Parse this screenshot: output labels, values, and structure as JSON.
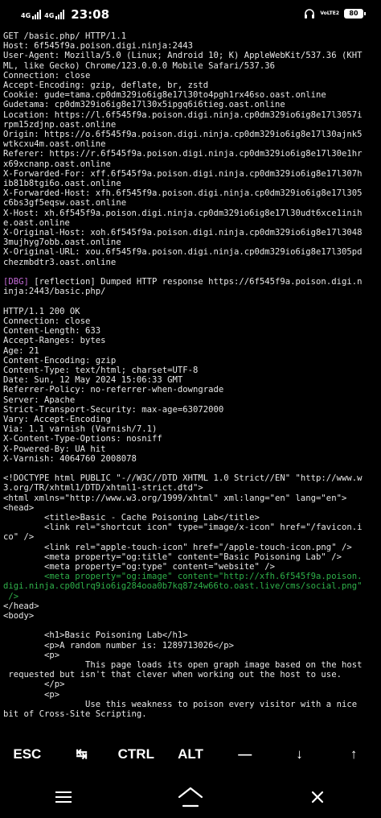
{
  "status_bar": {
    "sim1_label": "4G",
    "sim2_label": "4G",
    "time": "23:08",
    "volte_label": "VoLTE2",
    "battery_level": "80"
  },
  "terminal": {
    "lines": [
      {
        "text": "GET /basic.php/ HTTP/1.1"
      },
      {
        "text": "Host: 6f545f9a.poison.digi.ninja:2443"
      },
      {
        "text": "User-Agent: Mozilla/5.0 (Linux; Android 10; K) AppleWebKit/537.36 (KHT"
      },
      {
        "text": "ML, like Gecko) Chrome/123.0.0.0 Mobile Safari/537.36"
      },
      {
        "text": "Connection: close"
      },
      {
        "text": "Accept-Encoding: gzip, deflate, br, zstd"
      },
      {
        "text": "Cookie: gude=tama.cp0dm329io6ig8e17l30to4pgh1rx46so.oast.online"
      },
      {
        "text": "Gudetama: cp0dm329io6ig8e17l30x5ipgq6i6tieg.oast.online"
      },
      {
        "text": "Location: https://l.6f545f9a.poison.digi.ninja.cp0dm329io6ig8e17l3057i"
      },
      {
        "text": "rpm15zdjnp.oast.online"
      },
      {
        "text": "Origin: https://o.6f545f9a.poison.digi.ninja.cp0dm329io6ig8e17l30ajnk5"
      },
      {
        "text": "wtkcxu4m.oast.online"
      },
      {
        "text": "Referer: https://r.6f545f9a.poison.digi.ninja.cp0dm329io6ig8e17l30e1hr"
      },
      {
        "text": "x69xcnanp.oast.online"
      },
      {
        "text": "X-Forwarded-For: xff.6f545f9a.poison.digi.ninja.cp0dm329io6ig8e17l307h"
      },
      {
        "text": "ib81b8tgi6o.oast.online"
      },
      {
        "text": "X-Forwarded-Host: xfh.6f545f9a.poison.digi.ninja.cp0dm329io6ig8e17l305"
      },
      {
        "text": "c6bs3gf5eqsw.oast.online"
      },
      {
        "text": "X-Host: xh.6f545f9a.poison.digi.ninja.cp0dm329io6ig8e17l30udt6xce1inih"
      },
      {
        "text": "e.oast.online"
      },
      {
        "text": "X-Original-Host: xoh.6f545f9a.poison.digi.ninja.cp0dm329io6ig8e17l3048"
      },
      {
        "text": "3mujhyg7obb.oast.online"
      },
      {
        "text": "X-Original-URL: xou.6f545f9a.poison.digi.ninja.cp0dm329io6ig8e17l305pd"
      },
      {
        "text": "chezmbdtr3.oast.online"
      },
      {
        "text": ""
      },
      {
        "tag": "[DBG]",
        "text": " [reflection] Dumped HTTP response https://6f545f9a.poison.digi.n"
      },
      {
        "text": "inja:2443/basic.php/"
      },
      {
        "text": ""
      },
      {
        "text": "HTTP/1.1 200 OK"
      },
      {
        "text": "Connection: close"
      },
      {
        "text": "Content-Length: 633"
      },
      {
        "text": "Accept-Ranges: bytes"
      },
      {
        "text": "Age: 21"
      },
      {
        "text": "Content-Encoding: gzip"
      },
      {
        "text": "Content-Type: text/html; charset=UTF-8"
      },
      {
        "text": "Date: Sun, 12 May 2024 15:06:33 GMT"
      },
      {
        "text": "Referrer-Policy: no-referrer-when-downgrade"
      },
      {
        "text": "Server: Apache"
      },
      {
        "text": "Strict-Transport-Security: max-age=63072000"
      },
      {
        "text": "Vary: Accept-Encoding"
      },
      {
        "text": "Via: 1.1 varnish (Varnish/7.1)"
      },
      {
        "text": "X-Content-Type-Options: nosniff"
      },
      {
        "text": "X-Powered-By: UA hit"
      },
      {
        "text": "X-Varnish: 4064760 2008078"
      },
      {
        "text": ""
      },
      {
        "text": "<!DOCTYPE html PUBLIC \"-//W3C//DTD XHTML 1.0 Strict//EN\" \"http://www.w"
      },
      {
        "text": "3.org/TR/xhtml1/DTD/xhtml1-strict.dtd\">"
      },
      {
        "text": "<html xmlns=\"http://www.w3.org/1999/xhtml\" xml:lang=\"en\" lang=\"en\">"
      },
      {
        "text": "<head>"
      },
      {
        "text": "        <title>Basic - Cache Poisoning Lab</title>"
      },
      {
        "text": "        <link rel=\"shortcut icon\" type=\"image/x-icon\" href=\"/favicon.i"
      },
      {
        "text": "co\" />"
      },
      {
        "text": "        <link rel=\"apple-touch-icon\" href=\"/apple-touch-icon.png\" />"
      },
      {
        "text": "        <meta property=\"og:title\" content=\"Basic Poisoning Lab\" />"
      },
      {
        "text": "        <meta property=\"og:type\" content=\"website\" />"
      },
      {
        "text": "        <meta property=\"og:image\" content=\"http://xfh.6f545f9a.poison.",
        "color": "green"
      },
      {
        "text": "digi.ninja.cp0dlrq9io6ig284ooa0b7kq87z4w66to.oast.live/cms/social.png\"",
        "color": "green"
      },
      {
        "text": " />",
        "color": "green"
      },
      {
        "text": "</head>"
      },
      {
        "text": "<body>"
      },
      {
        "text": ""
      },
      {
        "text": "        <h1>Basic Poisoning Lab</h1>"
      },
      {
        "text": "        <p>A random number is: 1289713026</p>"
      },
      {
        "text": "        <p>"
      },
      {
        "text": "                This page loads its open graph image based on the host"
      },
      {
        "text": " requested but isn't that clever when working out the host to use."
      },
      {
        "text": "        </p>"
      },
      {
        "text": "        <p>"
      },
      {
        "text": "                Use this weakness to poison every visitor with a nice"
      },
      {
        "text": "bit of Cross-Site Scripting."
      }
    ]
  },
  "extra_keys": [
    {
      "label": "ESC",
      "name": "esc-key"
    },
    {
      "label": "↹",
      "name": "tab-key"
    },
    {
      "label": "CTRL",
      "name": "ctrl-key"
    },
    {
      "label": "ALT",
      "name": "alt-key"
    },
    {
      "label": "—",
      "name": "dash-key"
    },
    {
      "label": "↓",
      "name": "arrow-down-key"
    },
    {
      "label": "↑",
      "name": "arrow-up-key"
    }
  ],
  "colors": {
    "background": "#000000",
    "text": "#e8e8e8",
    "debug_tag": "#c56bd8",
    "highlight": "#2fb04a"
  },
  "icons": {
    "headphones": "headphones-icon",
    "menu": "menu-icon",
    "home": "home-icon",
    "back": "back-icon"
  }
}
